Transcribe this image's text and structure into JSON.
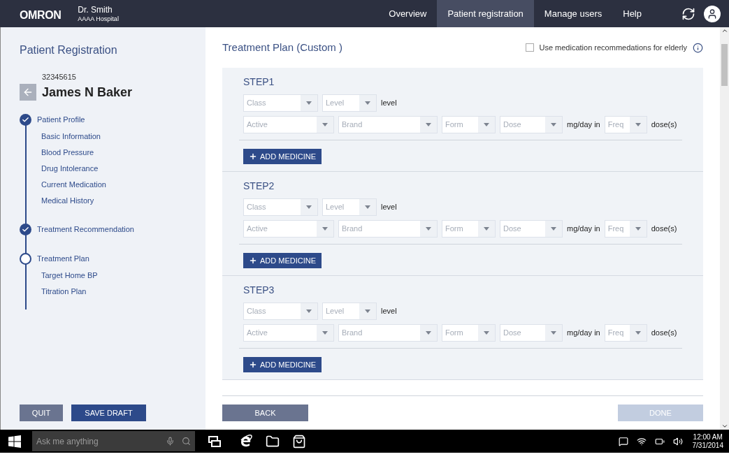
{
  "header": {
    "logo": "OMRON",
    "user": "Dr. Smith",
    "hospital": "AAAA Hospital",
    "nav": [
      {
        "label": "Overview",
        "selected": false
      },
      {
        "label": "Patient registration",
        "selected": true
      },
      {
        "label": "Manage users",
        "selected": false
      },
      {
        "label": "Help",
        "selected": false
      }
    ]
  },
  "sidebar": {
    "title": "Patient Registration",
    "patient_id": "32345615",
    "patient_name": "James N Baker",
    "sections": [
      {
        "label": "Patient Profile",
        "done": true,
        "children": [
          "Basic Information",
          "Blood Pressure",
          "Drug Intolerance",
          "Current Medication",
          "Medical History"
        ]
      },
      {
        "label": "Treatment Recommendation",
        "done": true
      },
      {
        "label": "Treatment Plan",
        "done": false,
        "children": [
          "Target Home BP",
          "Titration Plan"
        ]
      }
    ],
    "buttons": [
      "QUIT",
      "SAVE DRAFT"
    ]
  },
  "main": {
    "title": "Treatment Plan (Custom )",
    "elderly_option": {
      "label": "Use medication recommedations for elderly",
      "checked": false
    },
    "steps": [
      {
        "title": "STEP1",
        "rows": [
          [
            {
              "kind": "select",
              "placeholder": "Class"
            },
            {
              "kind": "select",
              "placeholder": "Level"
            },
            {
              "kind": "text",
              "text": "level"
            }
          ],
          [
            {
              "kind": "select",
              "placeholder": "Active"
            },
            {
              "kind": "select",
              "placeholder": "Brand"
            },
            {
              "kind": "select",
              "placeholder": "Form"
            },
            {
              "kind": "select",
              "placeholder": "Dose"
            },
            {
              "kind": "text",
              "text": "mg/day in"
            },
            {
              "kind": "select",
              "placeholder": "Freq"
            },
            {
              "kind": "text",
              "text": "dose(s)"
            }
          ]
        ],
        "add_button": "ADD MEDICINE"
      },
      {
        "title": "STEP2",
        "rows": [
          [
            {
              "kind": "select",
              "placeholder": "Class"
            },
            {
              "kind": "select",
              "placeholder": "Level"
            },
            {
              "kind": "text",
              "text": "level"
            }
          ],
          [
            {
              "kind": "select",
              "placeholder": "Active"
            },
            {
              "kind": "select",
              "placeholder": "Brand"
            },
            {
              "kind": "select",
              "placeholder": "Form"
            },
            {
              "kind": "select",
              "placeholder": "Dose"
            },
            {
              "kind": "text",
              "text": "mg/day in"
            },
            {
              "kind": "select",
              "placeholder": "Freq"
            },
            {
              "kind": "text",
              "text": "dose(s)"
            }
          ]
        ],
        "add_button": "ADD MEDICINE"
      },
      {
        "title": "STEP3",
        "rows": [
          [
            {
              "kind": "select",
              "placeholder": "Class"
            },
            {
              "kind": "select",
              "placeholder": "Level"
            },
            {
              "kind": "text",
              "text": "level"
            }
          ],
          [
            {
              "kind": "select",
              "placeholder": "Active"
            },
            {
              "kind": "select",
              "placeholder": "Brand"
            },
            {
              "kind": "select",
              "placeholder": "Form"
            },
            {
              "kind": "select",
              "placeholder": "Dose"
            },
            {
              "kind": "text",
              "text": "mg/day in"
            },
            {
              "kind": "select",
              "placeholder": "Freq"
            },
            {
              "kind": "text",
              "text": "dose(s)"
            }
          ]
        ],
        "add_button": "ADD MEDICINE"
      }
    ],
    "back_button": "BACK",
    "done_button": {
      "label": "DONE",
      "disabled": true
    }
  },
  "taskbar": {
    "search_placeholder": "Ask me anything",
    "time": "12:00 AM",
    "date": "7/31/2014"
  }
}
